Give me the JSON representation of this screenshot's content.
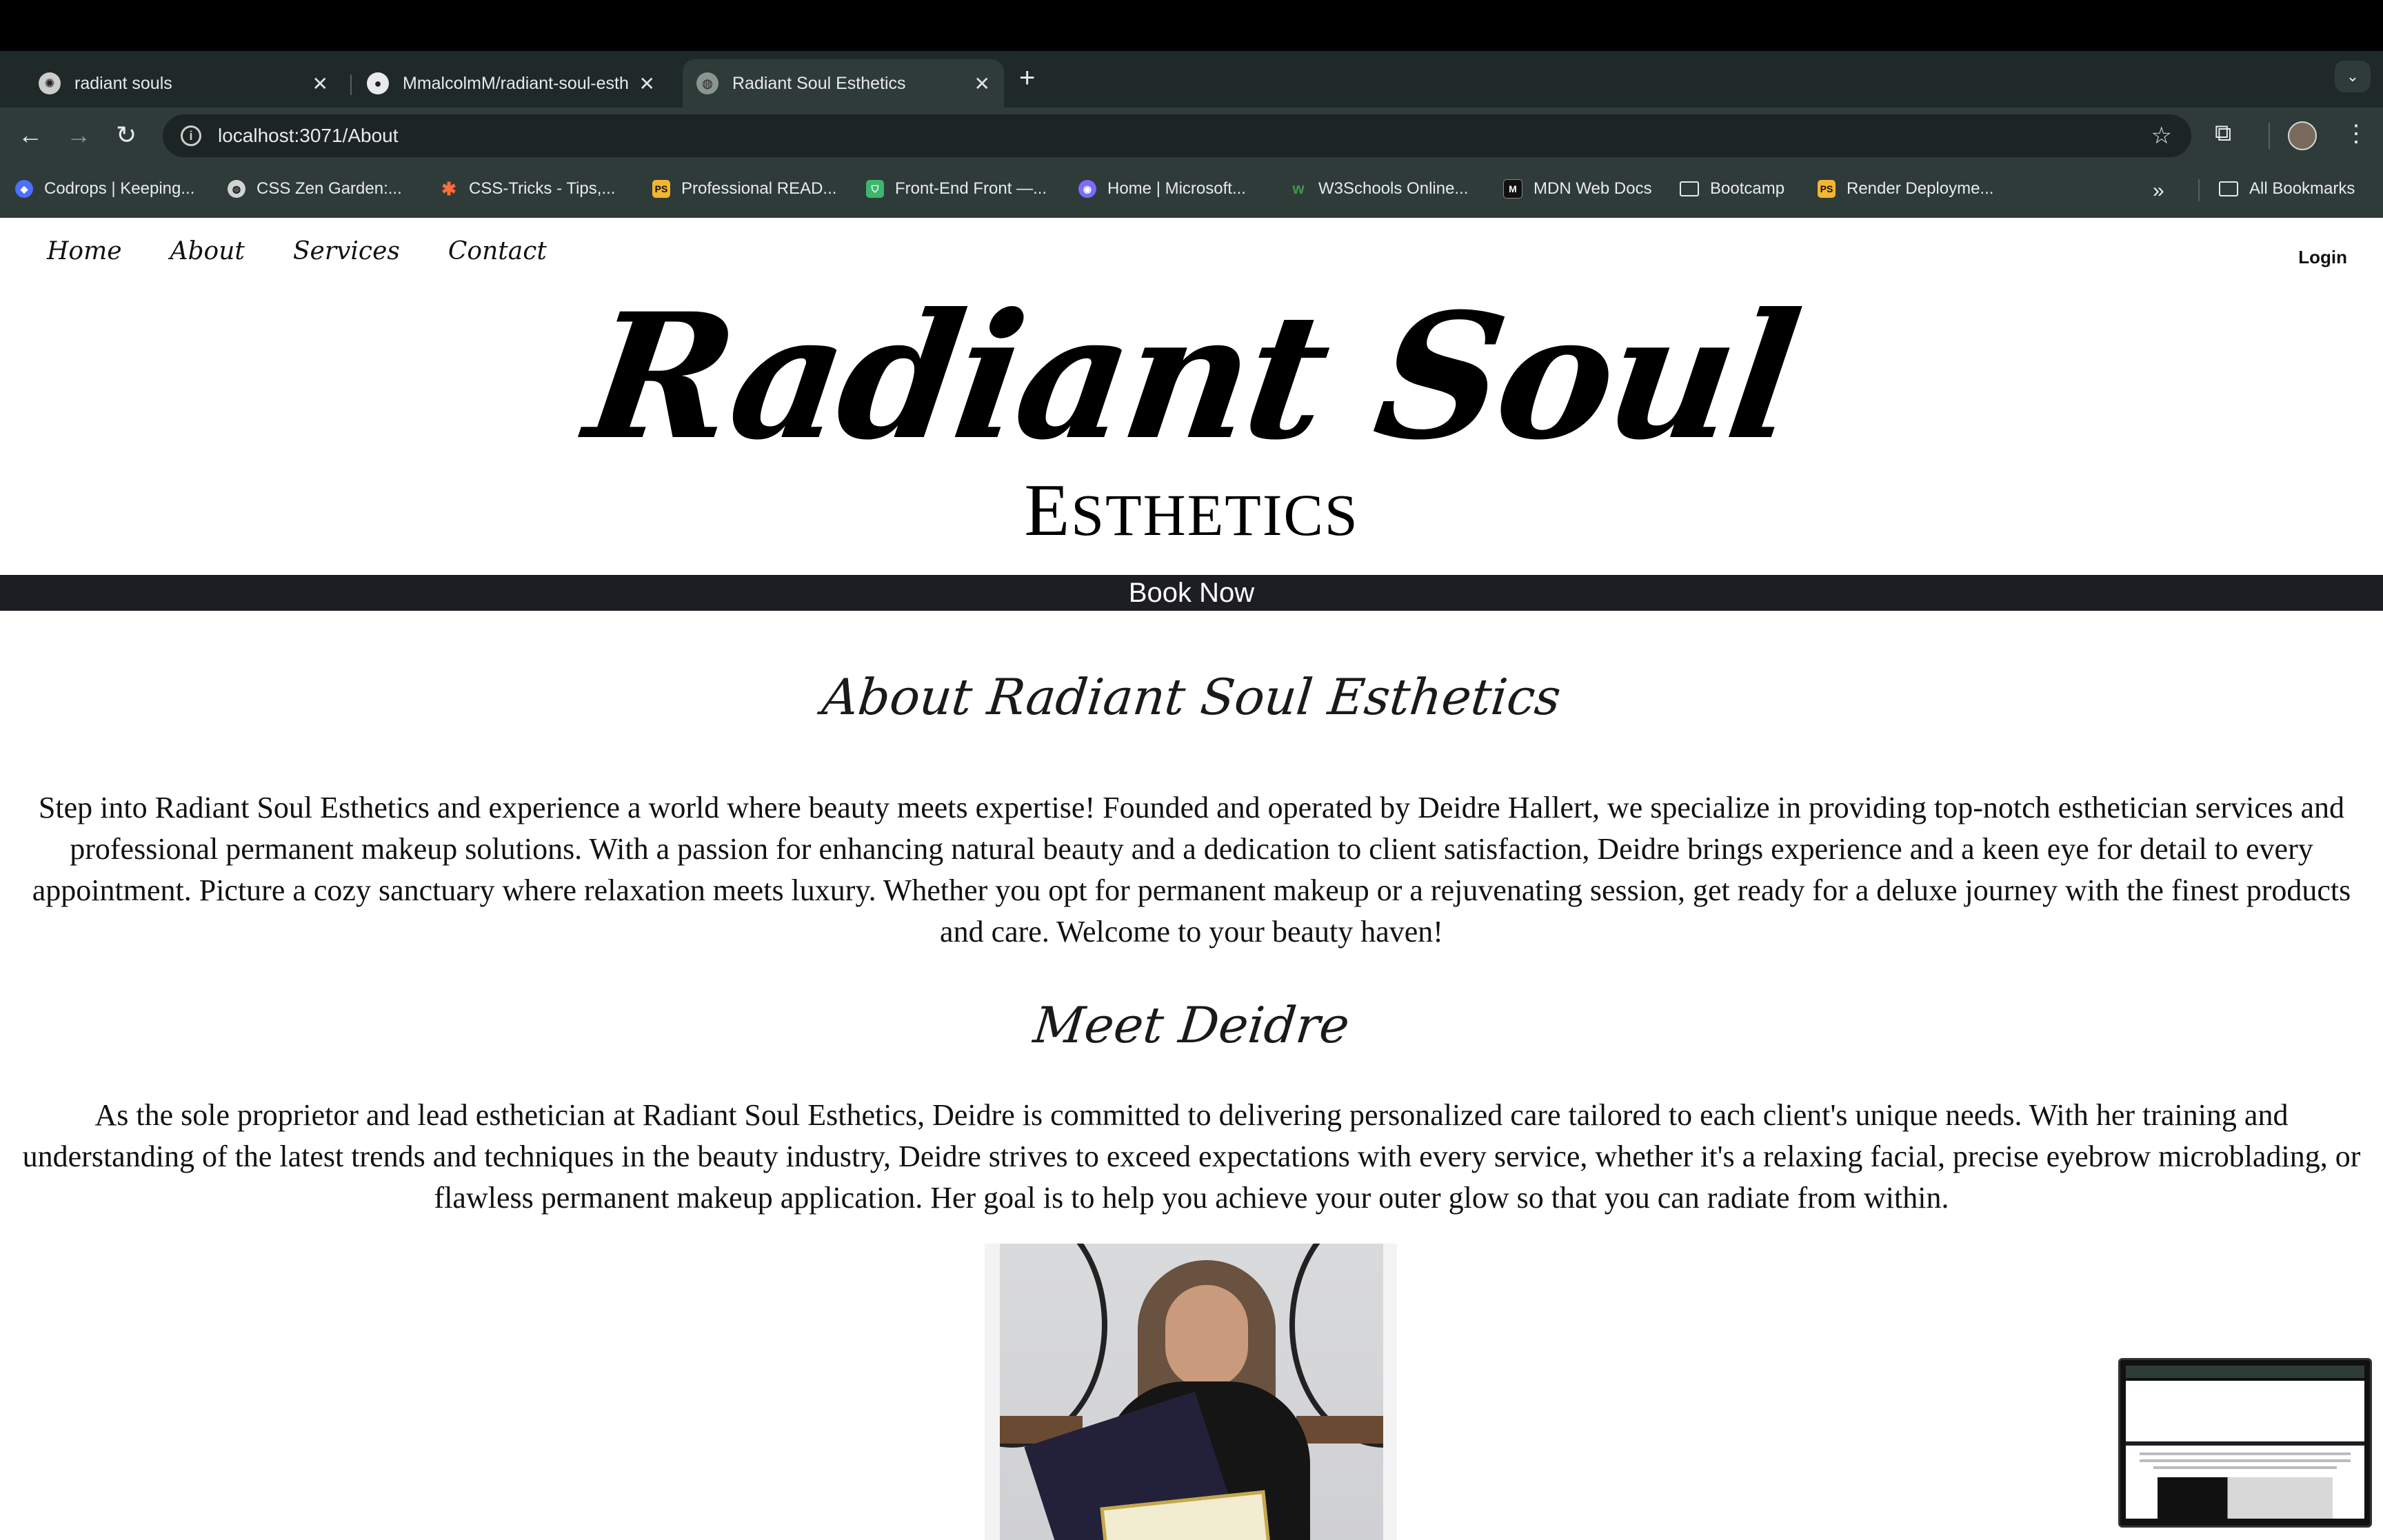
{
  "browser": {
    "tabs": [
      {
        "title": "radiant souls",
        "favicon": "openai-icon",
        "active": false
      },
      {
        "title": "MmalcolmM/radiant-soul-esthetics",
        "favicon": "github-icon",
        "active": false
      },
      {
        "title": "Radiant Soul Esthetics",
        "favicon": "globe-icon",
        "active": true
      }
    ],
    "url": "localhost:3071/About",
    "bookmarks": [
      {
        "label": "Codrops | Keeping...",
        "icon": "codrops-icon",
        "color": "#4b6fff"
      },
      {
        "label": "CSS Zen Garden:...",
        "icon": "globe-icon",
        "color": "#cfd3d1"
      },
      {
        "label": "CSS-Tricks - Tips,...",
        "icon": "star-icon",
        "color": "#ff6b3d"
      },
      {
        "label": "Professional READ...",
        "icon": "readme-icon",
        "color": "#f2b632"
      },
      {
        "label": "Front-End Front —...",
        "icon": "shield-icon",
        "color": "#3fb56e"
      },
      {
        "label": "Home | Microsoft...",
        "icon": "microsoft-icon",
        "color": "#7b6cff"
      },
      {
        "label": "W3Schools Online...",
        "icon": "w3schools-icon",
        "color": "#3c9a4a"
      },
      {
        "label": "MDN Web Docs",
        "icon": "mdn-icon",
        "color": "#e8eaed"
      },
      {
        "label": "Bootcamp",
        "icon": "folder-icon",
        "color": "#e8eaed"
      },
      {
        "label": "Render Deployme...",
        "icon": "readme-icon",
        "color": "#f2b632"
      }
    ],
    "all_bookmarks": "All Bookmarks"
  },
  "site": {
    "nav": [
      "Home",
      "About",
      "Services",
      "Contact"
    ],
    "login": "Login",
    "logo_script": "Radiant Soul",
    "logo_sub_first": "E",
    "logo_sub_rest": "STHETICS",
    "book_now": "Book Now",
    "about_heading": "About Radiant Soul Esthetics",
    "about_text": "Step into Radiant Soul Esthetics and experience a world where beauty meets expertise! Founded and operated by Deidre Hallert, we specialize in providing top-notch esthetician services and professional permanent makeup solutions. With a passion for enhancing natural beauty and a dedication to client satisfaction, Deidre brings experience and a keen eye for detail to every appointment. Picture a cozy sanctuary where relaxation meets luxury. Whether you opt for permanent makeup or a rejuvenating session, get ready for a deluxe journey with the finest products and care. Welcome to your beauty haven!",
    "meet_heading": "Meet Deidre",
    "meet_text": "As the sole proprietor and lead esthetician at Radiant Soul Esthetics, Deidre is committed to delivering personalized care tailored to each client's unique needs. With her training and understanding of the latest trends and techniques in the beauty industry, Deidre strives to exceed expectations with every service, whether it's a relaxing facial, precise eyebrow microblading, or flawless permanent makeup application. Her goal is to help you achieve your outer glow so that you can radiate from within."
  }
}
